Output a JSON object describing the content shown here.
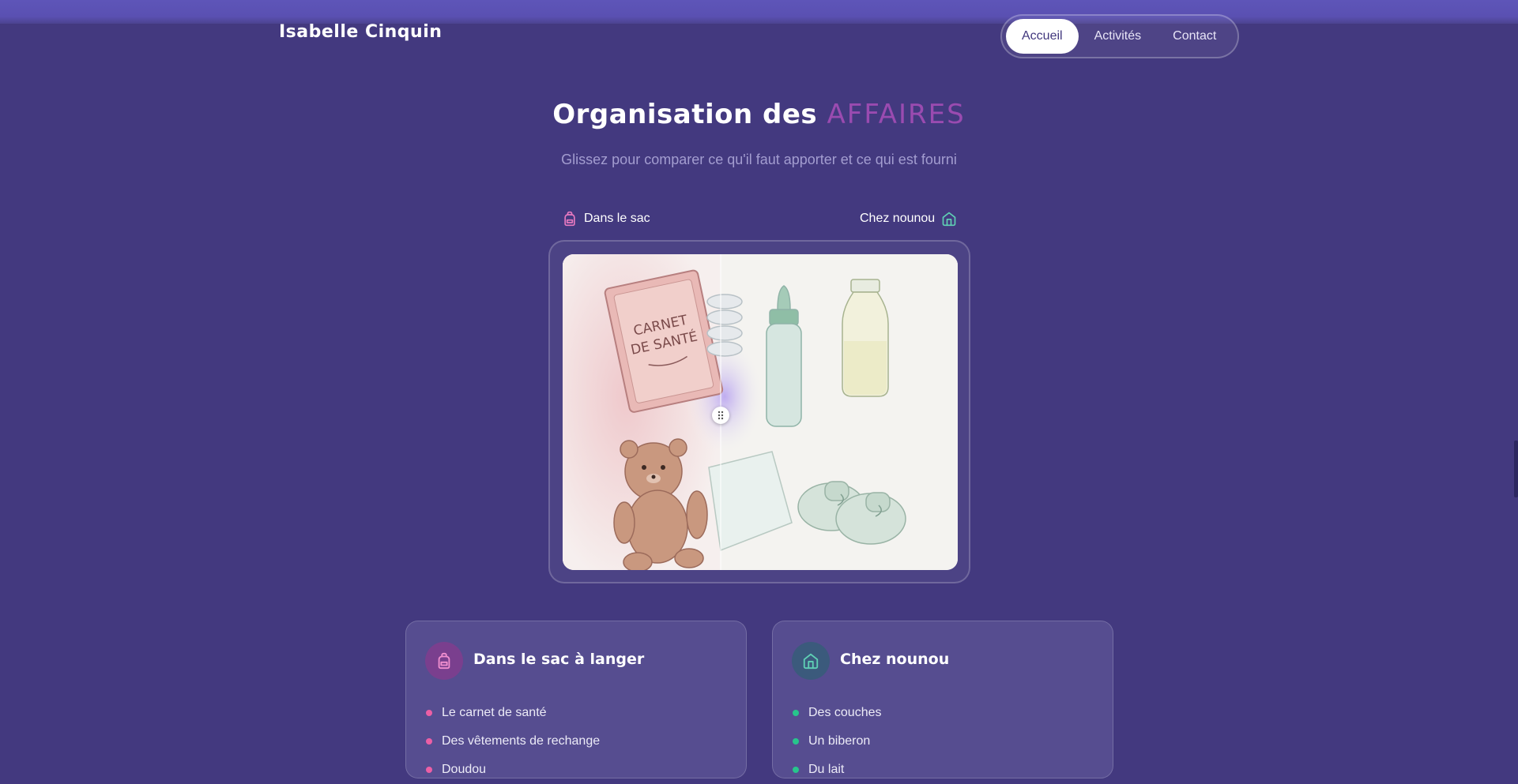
{
  "header": {
    "brand": "Isabelle Cinquin",
    "nav": [
      {
        "label": "Accueil",
        "active": true
      },
      {
        "label": "Activités",
        "active": false
      },
      {
        "label": "Contact",
        "active": false
      }
    ]
  },
  "section": {
    "title_main": "Organisation des ",
    "title_accent": "AFFAIRES",
    "subtitle": "Glissez pour comparer ce qu'il faut apporter et ce qui est fourni"
  },
  "compare": {
    "left_label": "Dans le sac",
    "right_label": "Chez nounou",
    "left_icon": "backpack-icon",
    "right_icon": "home-icon",
    "image_book_text_line1": "CARNET",
    "image_book_text_line2": "DE SANTÉ",
    "slider_position_percent": 40
  },
  "cards": {
    "left": {
      "title": "Dans le sac à langer",
      "icon": "backpack-icon",
      "items": [
        "Le carnet de santé",
        "Des vêtements de rechange",
        "Doudou"
      ]
    },
    "right": {
      "title": "Chez nounou",
      "icon": "home-icon",
      "items": [
        "Des couches",
        "Un biberon",
        "Du lait"
      ]
    }
  },
  "colors": {
    "background": "#43397f",
    "accent_purple": "#9a4bb0",
    "pink": "#ec5fa5",
    "green": "#27c58c",
    "teal_icon": "#5fd0b4"
  }
}
